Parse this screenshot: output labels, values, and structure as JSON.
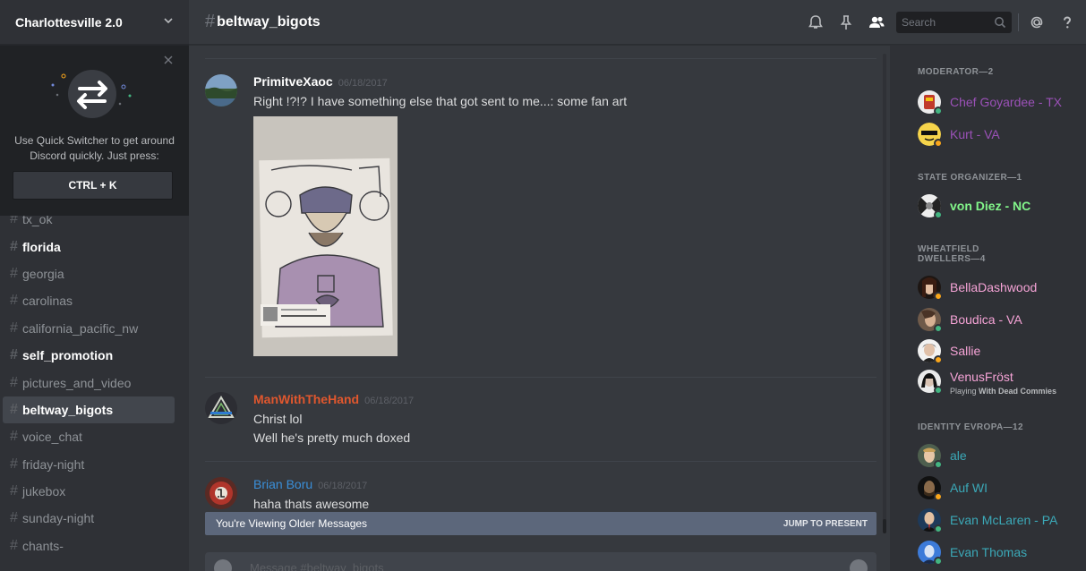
{
  "guild": {
    "name": "Charlottesville 2.0"
  },
  "quick_switcher": {
    "text": "Use Quick Switcher to get around Discord quickly. Just press:",
    "shortcut": "CTRL + K"
  },
  "channels": [
    {
      "name": "tx_ok",
      "state": "faded"
    },
    {
      "name": "florida",
      "state": "unread"
    },
    {
      "name": "georgia",
      "state": "normal"
    },
    {
      "name": "carolinas",
      "state": "normal"
    },
    {
      "name": "california_pacific_nw",
      "state": "normal"
    },
    {
      "name": "self_promotion",
      "state": "unread"
    },
    {
      "name": "pictures_and_video",
      "state": "normal"
    },
    {
      "name": "beltway_bigots",
      "state": "active"
    },
    {
      "name": "voice_chat",
      "state": "normal"
    },
    {
      "name": "friday-night",
      "state": "normal"
    },
    {
      "name": "jukebox",
      "state": "normal"
    },
    {
      "name": "sunday-night",
      "state": "normal"
    },
    {
      "name": "chants-",
      "state": "normal"
    }
  ],
  "channel_header": {
    "hash": "#",
    "name": "beltway_bigots",
    "search_placeholder": "Search"
  },
  "messages": [
    {
      "author": "PrimitveXaoc",
      "author_color": "#ffffff",
      "timestamp": "06/18/2017",
      "lines": [
        "Right !?!? I have something else that got sent to me...: some fan art"
      ],
      "has_image": true
    },
    {
      "author": "ManWithTheHand",
      "author_color": "#e0572e",
      "timestamp": "06/18/2017",
      "lines": [
        "Christ lol",
        "Well he's pretty much doxed"
      ]
    },
    {
      "author": "Brian Boru",
      "author_color": "#3a8fd9",
      "timestamp": "06/18/2017",
      "lines": [
        "haha thats awesome"
      ]
    }
  ],
  "older_bar": {
    "text": "You're Viewing Older Messages",
    "jump": "JUMP TO PRESENT"
  },
  "composer": {
    "placeholder": "Message #beltway_bigots"
  },
  "member_groups": [
    {
      "title": "MODERATOR—2",
      "members": [
        {
          "name": "Chef Goyardee - TX",
          "color": "#9b51b8",
          "status": "online"
        },
        {
          "name": "Kurt - VA",
          "color": "#9b51b8",
          "status": "idle"
        }
      ]
    },
    {
      "title": "STATE ORGANIZER—1",
      "members": [
        {
          "name": "von Diez - NC",
          "color": "#82f58a",
          "status": "online"
        }
      ]
    },
    {
      "title": "WHEATFIELD DWELLERS—4",
      "members": [
        {
          "name": "BellaDashwood",
          "color": "#f5a3d6",
          "status": "idle"
        },
        {
          "name": "Boudica - VA",
          "color": "#f5a3d6",
          "status": "online"
        },
        {
          "name": "Sallie",
          "color": "#f5a3d6",
          "status": "idle"
        },
        {
          "name": "VenusFröst",
          "color": "#f5a3d6",
          "status": "online",
          "activity_prefix": "Playing",
          "activity": "With Dead Commies"
        }
      ]
    },
    {
      "title": "IDENTITY EVROPA—12",
      "members": [
        {
          "name": "ale",
          "color": "#3ba9b8",
          "status": "online"
        },
        {
          "name": "Auf WI",
          "color": "#3ba9b8",
          "status": "idle"
        },
        {
          "name": "Evan McLaren - PA",
          "color": "#3ba9b8",
          "status": "online"
        },
        {
          "name": "Evan Thomas",
          "color": "#3ba9b8",
          "status": "online"
        }
      ]
    }
  ],
  "colors": {
    "online": "#43b581",
    "idle": "#faa61a",
    "accent": "#7289da"
  },
  "icons": [
    "chevron-down-icon",
    "close-icon",
    "swap-arrows-icon",
    "bell-icon",
    "pin-icon",
    "members-icon",
    "search-icon",
    "at-icon",
    "help-icon"
  ]
}
